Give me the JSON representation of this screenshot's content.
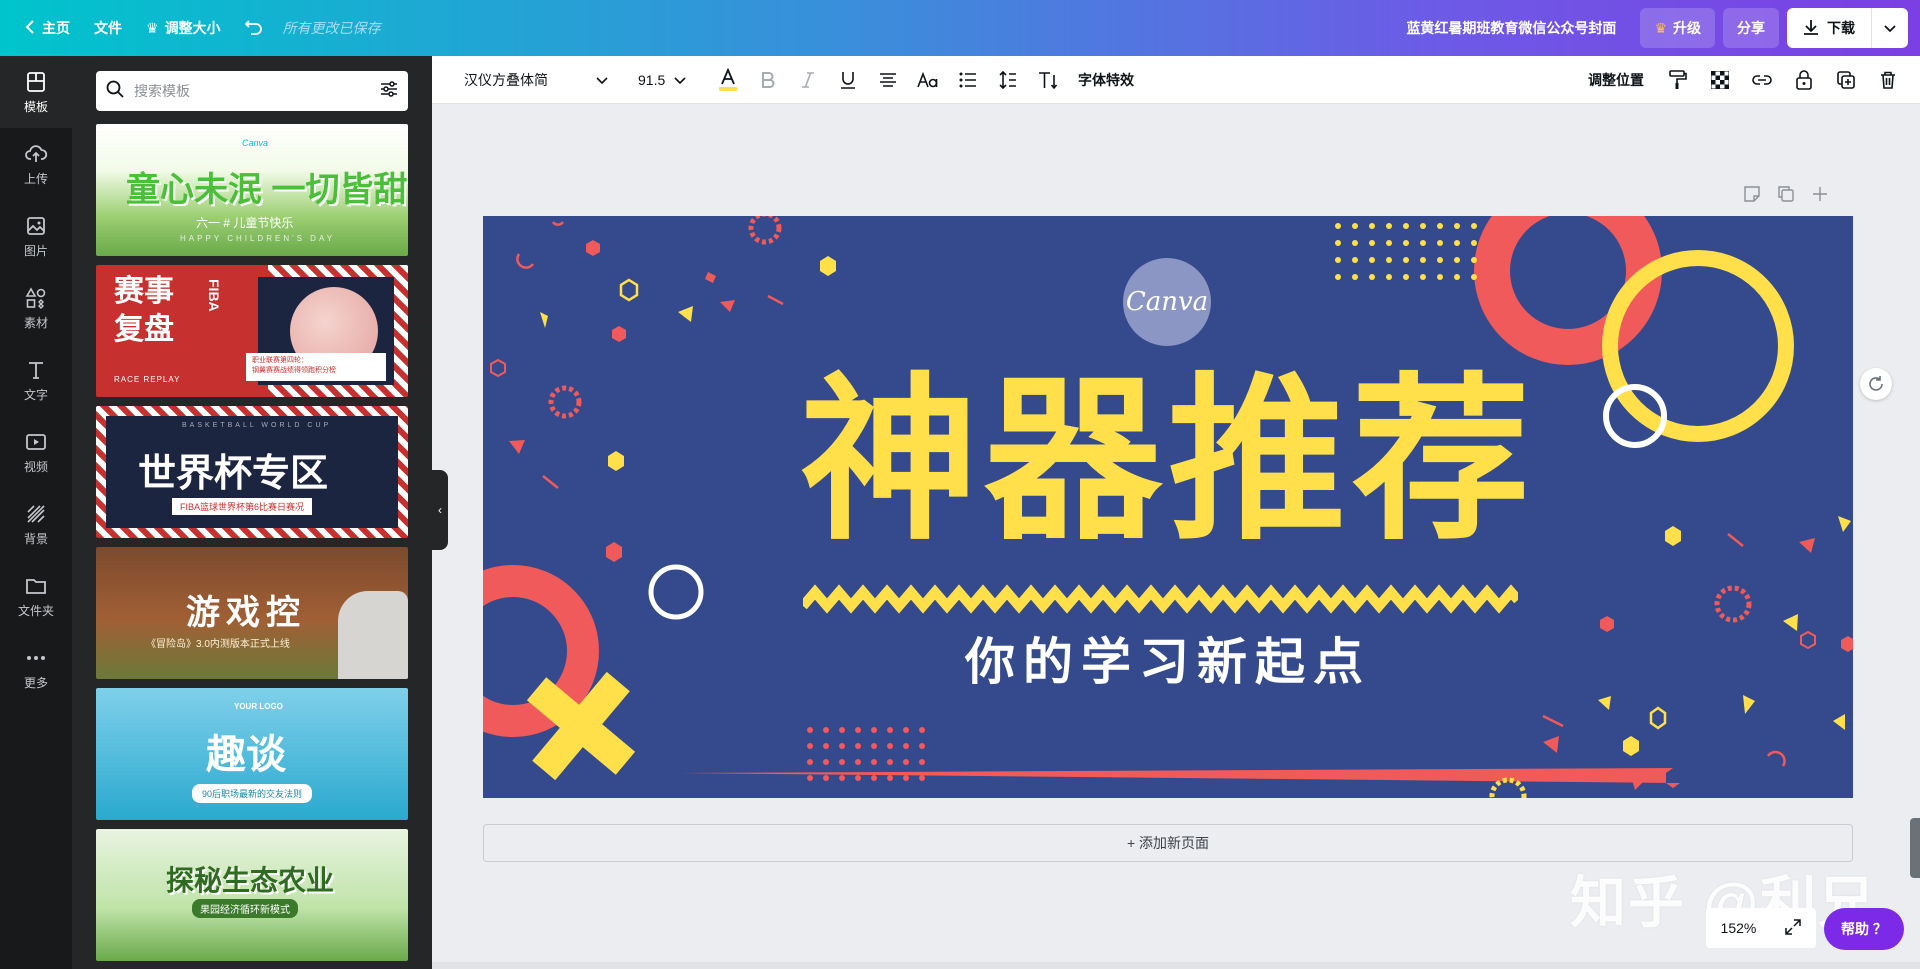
{
  "topbar": {
    "home": "主页",
    "file": "文件",
    "resize": "调整大小",
    "saved": "所有更改已保存",
    "doc_title": "蓝黄红暑期班教育微信公众号封面",
    "upgrade": "升级",
    "share": "分享",
    "download": "下载"
  },
  "rail": {
    "items": [
      {
        "label": "模板",
        "icon": "template-icon"
      },
      {
        "label": "上传",
        "icon": "upload-icon"
      },
      {
        "label": "图片",
        "icon": "photo-icon"
      },
      {
        "label": "素材",
        "icon": "elements-icon"
      },
      {
        "label": "文字",
        "icon": "text-icon"
      },
      {
        "label": "视频",
        "icon": "video-icon"
      },
      {
        "label": "背景",
        "icon": "background-icon"
      },
      {
        "label": "文件夹",
        "icon": "folder-icon"
      },
      {
        "label": "更多",
        "icon": "more-icon"
      }
    ]
  },
  "search": {
    "placeholder": "搜索模板"
  },
  "templates": [
    {
      "title": "童心未泯 一切皆甜",
      "sub": "六一 # 儿童节快乐",
      "sub2": "HAPPY CHILDREN'S DAY",
      "logo": "Canva"
    },
    {
      "title": "赛事\n复盘",
      "fiba": "FIBA",
      "note": "职业联赛第四轮：\n钢翼赛赛战绩得领跑积分榜",
      "race": "RACE REPLAY"
    },
    {
      "title": "世界杯专区",
      "top": "BASKETBALL WORLD CUP",
      "sub": "FIBA篮球世界杯第6比赛日赛况"
    },
    {
      "title": "游戏控",
      "sub": "《冒险岛》3.0内测版本正式上线"
    },
    {
      "title": "趣谈",
      "sub": "90后职场最新的交友法则",
      "logo": "YOUR LOGO"
    },
    {
      "title": "探秘生态农业",
      "sub": "果园经济循环新模式"
    }
  ],
  "editor": {
    "font": "汉仪方叠体简",
    "size": "91.5",
    "effects": "字体特效",
    "position": "调整位置"
  },
  "design": {
    "logo": "Canva",
    "title": "神器推荐",
    "subtitle": "你的学习新起点",
    "colors": {
      "bg": "#344a8c",
      "yellow": "#ffe04b",
      "red": "#f05a5a",
      "white": "#ffffff"
    }
  },
  "add_page": "+ 添加新页面",
  "watermark": "知乎 @利兄",
  "zoom": "152%",
  "help": "帮助 ？"
}
